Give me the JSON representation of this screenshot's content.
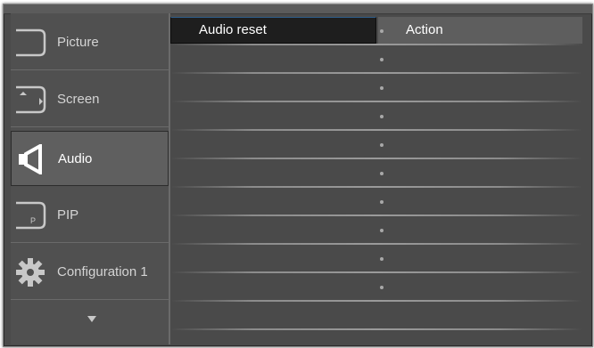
{
  "sidebar": {
    "items": [
      {
        "label": "Picture",
        "icon": "picture-icon"
      },
      {
        "label": "Screen",
        "icon": "screen-icon"
      },
      {
        "label": "Audio",
        "icon": "speaker-icon"
      },
      {
        "label": "PIP",
        "icon": "pip-icon"
      },
      {
        "label": "Configuration 1",
        "icon": "gear-icon"
      }
    ],
    "more_icon": "chevron-down-icon"
  },
  "content": {
    "selected_item": "Audio reset",
    "selected_value": "Action"
  },
  "colors": {
    "panel_bg": "#4a4a4a",
    "selection_bg": "#1e1e1e",
    "text": "#ffffff"
  }
}
